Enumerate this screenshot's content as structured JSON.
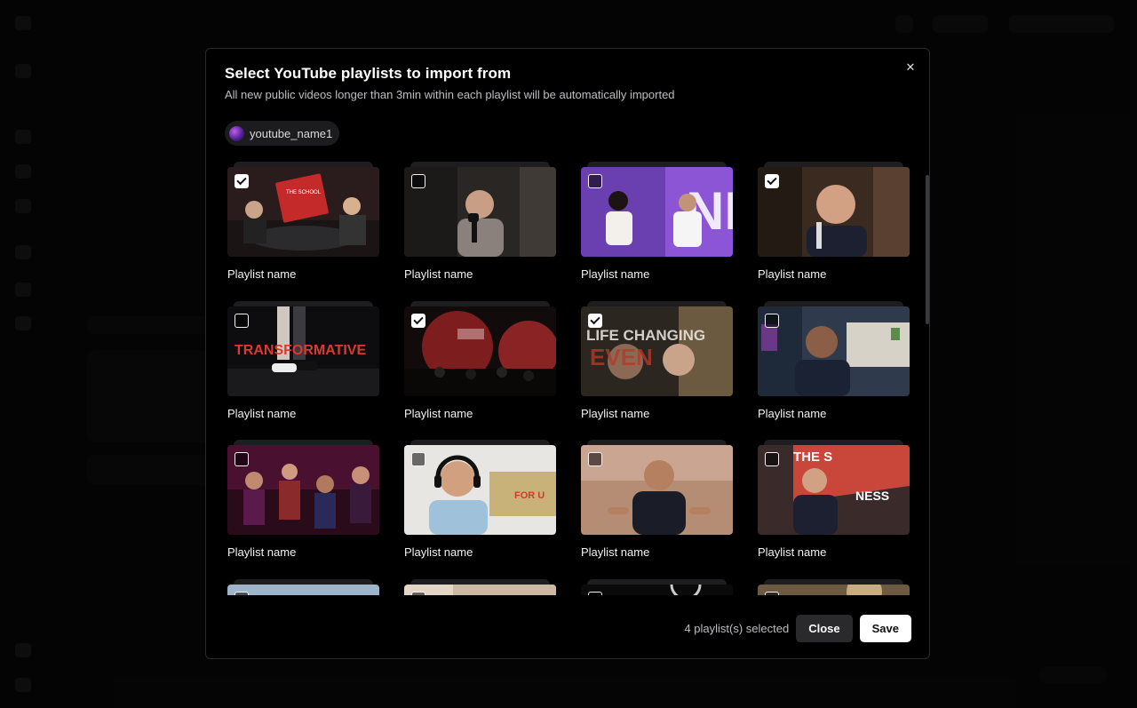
{
  "modal": {
    "title": "Select YouTube playlists to import from",
    "subtitle": "All new public videos longer than 3min within each playlist will be automatically imported",
    "close_icon": "close-icon",
    "account": {
      "name": "youtube_name1",
      "avatar_icon": "youtube-avatar"
    },
    "playlists": [
      {
        "label": "Playlist name",
        "checked": true,
        "thumb": "podcast-studio-red"
      },
      {
        "label": "Playlist name",
        "checked": false,
        "thumb": "man-microphone"
      },
      {
        "label": "Playlist name",
        "checked": false,
        "thumb": "stage-interview-purple"
      },
      {
        "label": "Playlist name",
        "checked": true,
        "thumb": "man-speaking-closeup"
      },
      {
        "label": "Playlist name",
        "checked": false,
        "thumb": "transformative-text",
        "text": "TRANSFORMATIVE"
      },
      {
        "label": "Playlist name",
        "checked": true,
        "thumb": "concert-red"
      },
      {
        "label": "Playlist name",
        "checked": true,
        "thumb": "life-changing-event",
        "text": "LIFE CHANGING"
      },
      {
        "label": "Playlist name",
        "checked": false,
        "thumb": "man-blue-office"
      },
      {
        "label": "Playlist name",
        "checked": false,
        "thumb": "party-crowd"
      },
      {
        "label": "Playlist name",
        "checked": false,
        "thumb": "man-headphones"
      },
      {
        "label": "Playlist name",
        "checked": false,
        "thumb": "speaker-tent"
      },
      {
        "label": "Playlist name",
        "checked": false,
        "thumb": "greatness-stage"
      },
      {
        "label": "",
        "checked": false,
        "thumb": "city-sky"
      },
      {
        "label": "",
        "checked": false,
        "thumb": "beige-room"
      },
      {
        "label": "",
        "checked": false,
        "thumb": "dark-ring"
      },
      {
        "label": "",
        "checked": false,
        "thumb": "gold-texture"
      }
    ],
    "footer": {
      "selected_text": "4 playlist(s) selected",
      "close_label": "Close",
      "save_label": "Save"
    }
  }
}
